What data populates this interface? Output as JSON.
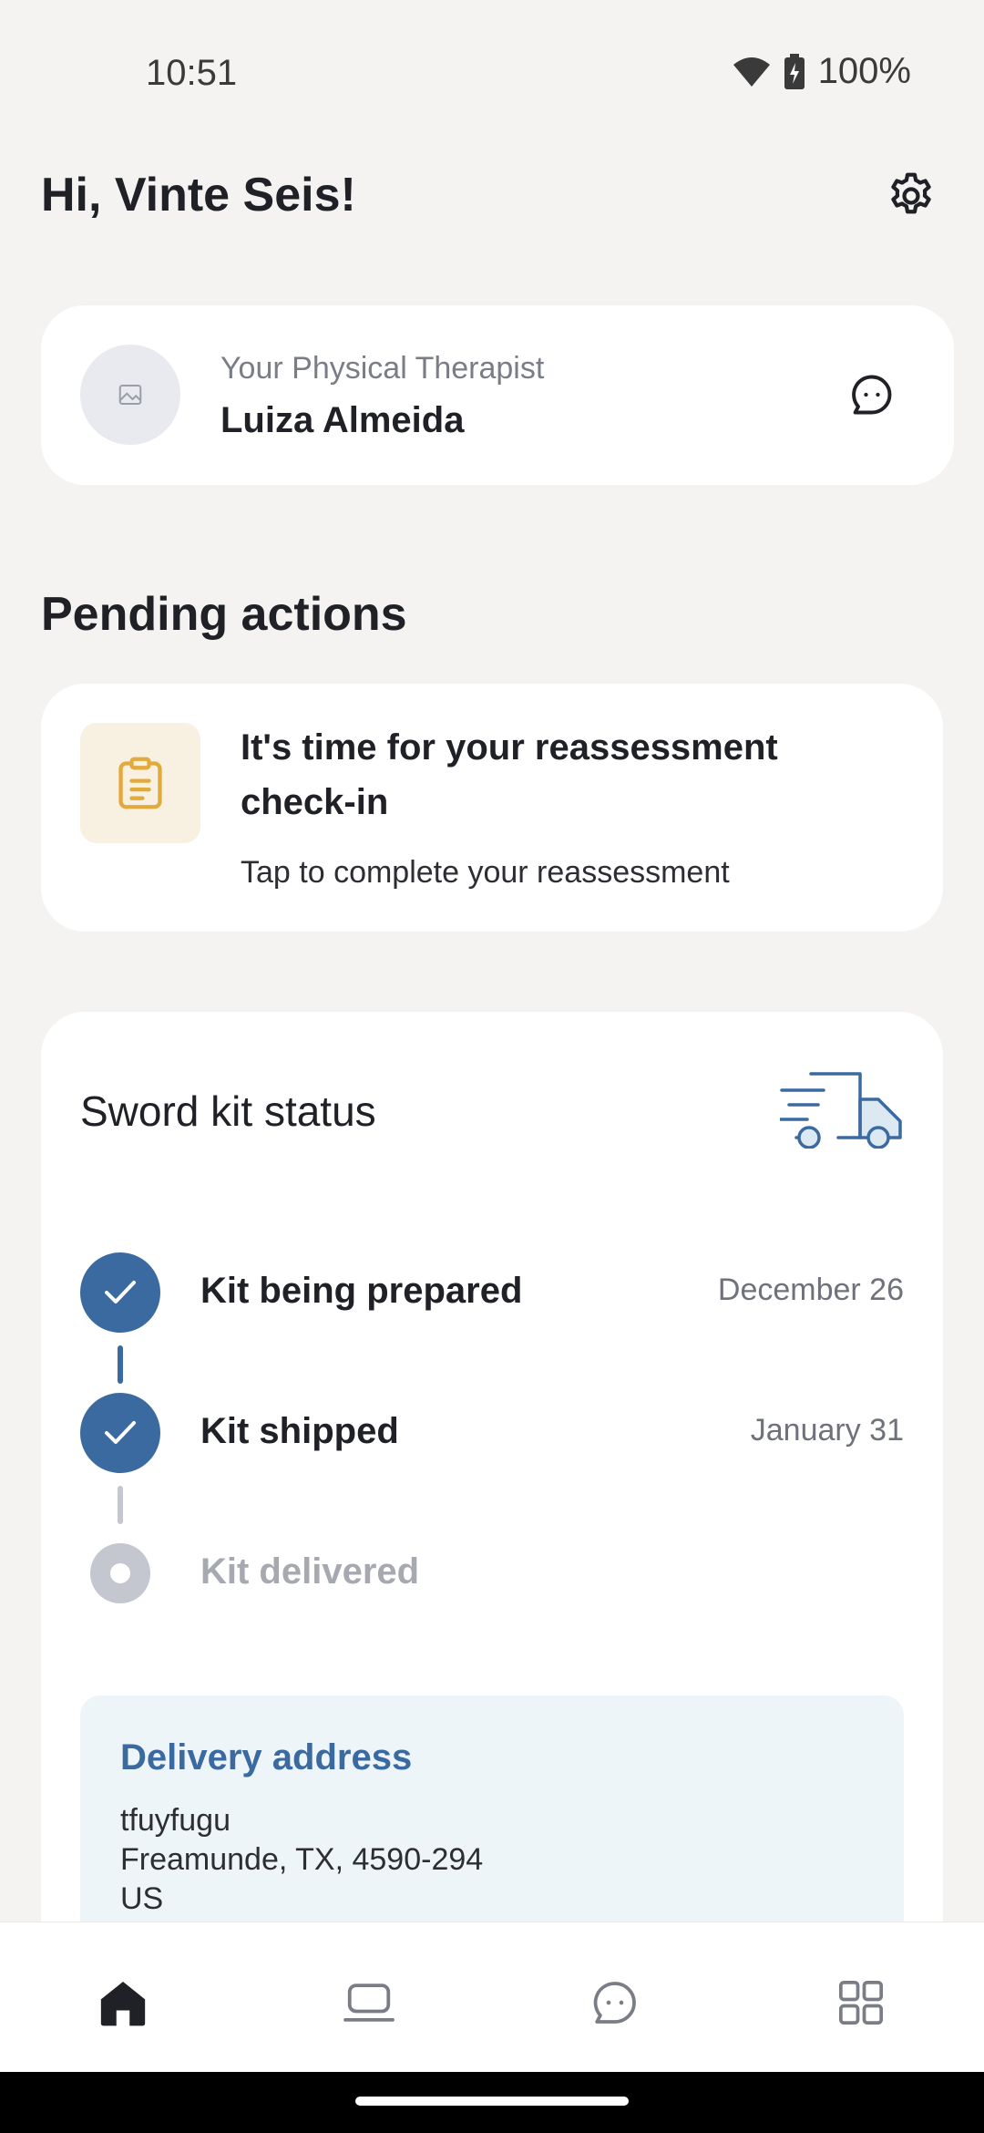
{
  "status_bar": {
    "time": "10:51",
    "battery": "100%"
  },
  "header": {
    "greeting": "Hi, Vinte Seis!"
  },
  "therapist": {
    "role": "Your Physical Therapist",
    "name": "Luiza Almeida"
  },
  "pending": {
    "section_title": "Pending actions",
    "card_title": "It's time for your reassessment check-in",
    "card_subtitle": "Tap to complete your reassessment"
  },
  "kit": {
    "title": "Sword kit status",
    "steps": [
      {
        "label": "Kit being prepared",
        "date": "December 26",
        "done": true
      },
      {
        "label": "Kit shipped",
        "date": "January 31",
        "done": true
      },
      {
        "label": "Kit delivered",
        "date": "",
        "done": false
      }
    ],
    "address": {
      "title": "Delivery address",
      "lines": [
        "tfuyfugu",
        "Freamunde, TX, 4590-294",
        "US"
      ]
    }
  },
  "colors": {
    "accent": "#3b6aa0",
    "background": "#f4f3f1",
    "pending_gray": "#c4c7cf",
    "action_icon_bg": "#f8f0e1"
  },
  "icons": {
    "settings": "gear-icon",
    "chat": "chat-bubble-icon",
    "action": "clipboard-icon",
    "truck": "delivery-truck-icon",
    "nav": [
      "home-icon",
      "laptop-icon",
      "chat-icon",
      "grid-icon"
    ]
  }
}
